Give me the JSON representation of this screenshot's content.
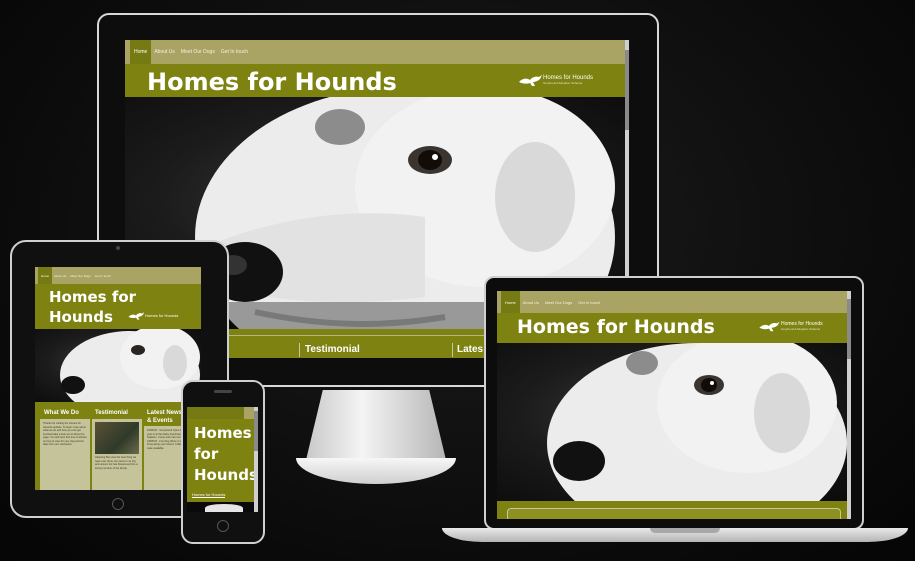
{
  "site": {
    "title": "Homes for Hounds",
    "logo_text": "Homes for Hounds",
    "logo_subtext": "Greyhound Adoption Scheme",
    "nav": [
      "Home",
      "About Us",
      "Meet Our Dogs",
      "Get In touch"
    ]
  },
  "monitor": {
    "sections": [
      "Testimonial",
      "Lates"
    ]
  },
  "tablet": {
    "title_line1": "Homes for",
    "title_line2": "Hounds",
    "columns": [
      {
        "heading": "What We Do",
        "text": "Thanks for visiting the Homes for Hounds website. To learn more about what we do and how you can get involved take a look at our About Us page. You will soon find lots of articles on how to care for your dog and fun tales from our volunteers."
      },
      {
        "heading": "Testimonial",
        "text": "Adopting Ben was the best thing we have ever done. He came to us shy and unsure but has blossomed into a loving member of the family."
      },
      {
        "heading": "Latest News",
        "heading2": "& Events",
        "text": "16/06/15 - Greyhound Open Day this year is at the Daisy Greyhound Stadium. Come and meet our dogs. 23/05/15 - Fun Dog Show in the park, bring along your hound. Coffee and cake available."
      }
    ]
  },
  "phone": {
    "title_lines": [
      "Homes",
      "for",
      "Hounds"
    ]
  },
  "colors": {
    "nav": "#a9a463",
    "header": "#7e8210",
    "active_tab": "#767a12",
    "column_bg": "#c5c39a"
  }
}
